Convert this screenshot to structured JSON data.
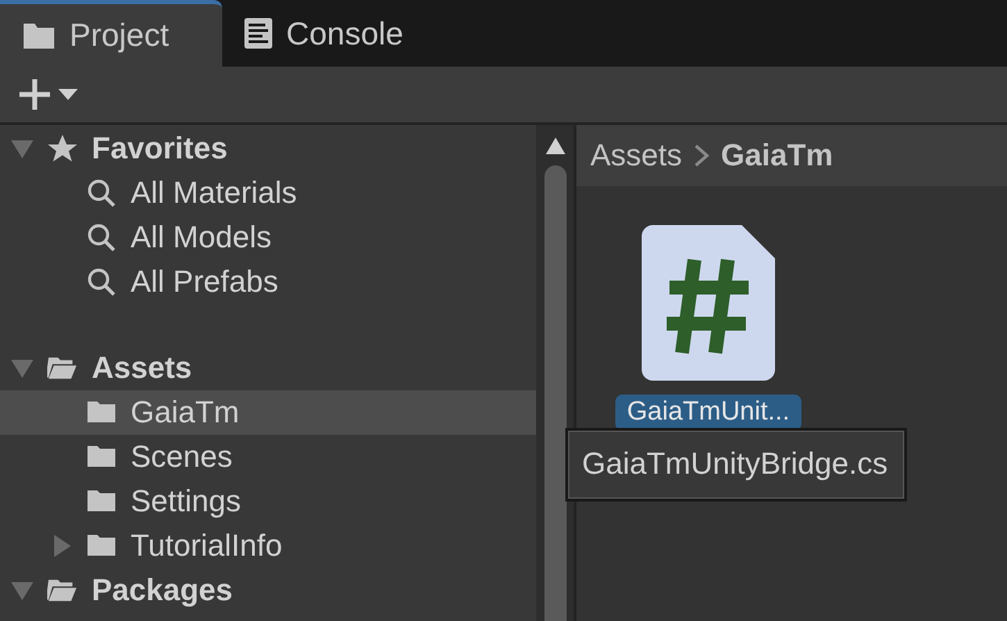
{
  "tabs": [
    {
      "label": "Project",
      "kind": "project",
      "selected": true
    },
    {
      "label": "Console",
      "kind": "console",
      "selected": false
    }
  ],
  "tree": [
    {
      "label": "Favorites",
      "kind": "favorites",
      "expanded": true,
      "selected": false,
      "children": [
        {
          "label": "All Materials",
          "kind": "search",
          "selected": false
        },
        {
          "label": "All Models",
          "kind": "search",
          "selected": false
        },
        {
          "label": "All Prefabs",
          "kind": "search",
          "selected": false
        }
      ]
    },
    {
      "label": "Assets",
      "kind": "folder",
      "expanded": true,
      "selected": false,
      "children": [
        {
          "label": "GaiaTm",
          "kind": "folder",
          "selected": true
        },
        {
          "label": "Scenes",
          "kind": "folder",
          "selected": false
        },
        {
          "label": "Settings",
          "kind": "folder",
          "selected": false
        },
        {
          "label": "TutorialInfo",
          "kind": "folder",
          "expanded": false,
          "selected": false
        }
      ]
    },
    {
      "label": "Packages",
      "kind": "folder",
      "expanded": true,
      "selected": false
    }
  ],
  "breadcrumb": [
    "Assets",
    "GaiaTm"
  ],
  "files": [
    {
      "name": "GaiaTmUnit...",
      "kind": "script",
      "selected": true
    }
  ],
  "tooltip": "GaiaTmUnityBridge.cs"
}
